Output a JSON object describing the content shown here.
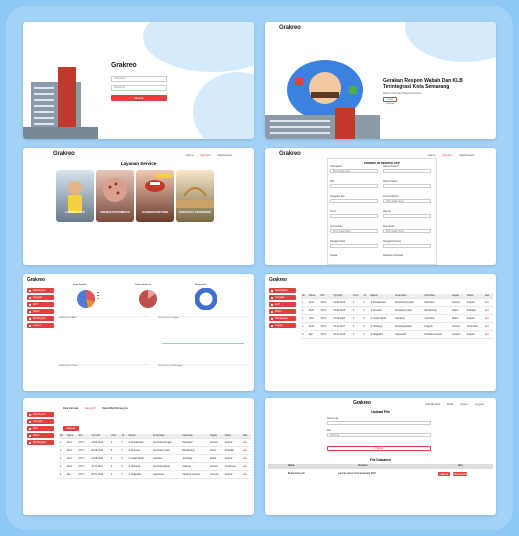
{
  "brand": {
    "logo_text": "Grakreo"
  },
  "colors": {
    "accent": "#e0413e",
    "background": "#8ec9f3",
    "blob": "#d5ebfb"
  },
  "login": {
    "username_placeholder": "Username",
    "password_placeholder": "Password",
    "submit_label": "Masuk"
  },
  "landing": {
    "nav": [
      "Home",
      "Service",
      "Dashboard"
    ],
    "headline": "Gerakan Respon Wabah Dan KLB Terintegrasi Kota Semarang",
    "subtext": "Sistem Informasi Pelaporan Kasus",
    "cta_label": "Lihat Layanan"
  },
  "services": {
    "nav": [
      "Home",
      "Service",
      "Dashboard"
    ],
    "title": "Layanan Service",
    "cards": [
      {
        "label": "CAMPAK AFP",
        "icon": "child-icon"
      },
      {
        "label": "MONKEYPOX/MPOX",
        "icon": "skin-icon"
      },
      {
        "label": "GONDOK/DIFTERI",
        "icon": "throat-icon"
      },
      {
        "label": "PENYAKIT ZOONOSIS",
        "icon": "zoonosis-icon"
      }
    ]
  },
  "form": {
    "nav": [
      "Home",
      "Service",
      "Dashboard"
    ],
    "title": "FORMULIR DEDIKSI AFP",
    "fields": [
      "Kabupaten",
      "Nama Pelapor",
      "NIK",
      "Nama Kasus",
      "Tanggal Lahir",
      "Jenis Kelamin",
      "Umur",
      "Alamat",
      "Kecamatan",
      "Kelurahan",
      "Tanggal Sakit",
      "Tanggal Periksa",
      "Gejala",
      "Riwayat Imunisasi"
    ],
    "select_value": "Pilih Salah Satu"
  },
  "dashboard": {
    "menu": [
      "Dashboard",
      "Campak",
      "AFP",
      "Difteri",
      "Monkeypox",
      "Logout"
    ],
    "charts": [
      "Jenis Kelamin",
      "Status Imunisasi",
      "Kecamatan"
    ],
    "line_charts": [
      "Grafik Kasus AFP",
      "Grafik Kasus Campak",
      "Grafik Kasus Difteri",
      "Grafik Kasus Monkeypox"
    ]
  },
  "table_view": {
    "menu": [
      "Dashboard",
      "Campak",
      "AFP",
      "Difteri",
      "Monkeypox",
      "Logout"
    ],
    "columns": [
      "No",
      "Nama",
      "NIK",
      "Tgl Lahir",
      "Umur",
      "JK",
      "Alamat",
      "Kecamatan",
      "Kelurahan",
      "Gejala",
      "Status",
      "Aksi"
    ],
    "rows": [
      [
        "1",
        "Arief",
        "3374...",
        "12-03-2019",
        "4",
        "L",
        "Jl. Pandanaran",
        "Semarang Tengah",
        "Pekunden",
        "Demam",
        "Suspek",
        "Edit"
      ],
      [
        "2",
        "Budi",
        "3374...",
        "02-05-2018",
        "5",
        "L",
        "Jl. Pemuda",
        "Semarang Utara",
        "Bandarharjo",
        "Ruam",
        "Probable",
        "Edit"
      ],
      [
        "3",
        "Citra",
        "3374...",
        "21-08-2020",
        "3",
        "P",
        "Jl. Gajah Mada",
        "Candisari",
        "Jomblang",
        "Batuk",
        "Suspek",
        "Edit"
      ],
      [
        "4",
        "Dewi",
        "3374...",
        "15-11-2017",
        "6",
        "P",
        "Jl. Siliwangi",
        "Semarang Barat",
        "Krapyak",
        "Demam",
        "Konfirmasi",
        "Edit"
      ],
      [
        "5",
        "Eko",
        "3374...",
        "30-01-2019",
        "4",
        "L",
        "Jl. Majapahit",
        "Gayamsari",
        "Pandean Lamper",
        "Lumpuh",
        "Suspek",
        "Edit"
      ]
    ]
  },
  "table_view2": {
    "menu": [
      "Dashboard",
      "Campak",
      "AFP",
      "Difteri",
      "Monkeypox"
    ],
    "tabs": [
      "Data Campak",
      "Data AFP",
      "Data Difteri/Monkeypox"
    ],
    "export_label": "Export Excel"
  },
  "upload": {
    "nav": [
      "Dashboard",
      "Data",
      "Users",
      "Logout"
    ],
    "title": "Upload File",
    "name_label": "Nama File",
    "file_label": "File",
    "file_value": "Pilih File",
    "submit_label": "Upload",
    "docs_title": "File Dokumen",
    "doc_columns": [
      "Nama",
      "Deskripsi",
      "Aksi"
    ],
    "doc_row": [
      "Berita Acara.pdf",
      "Laporan Kasus Kota Semarang 2023",
      "Hapus",
      "Download"
    ]
  }
}
